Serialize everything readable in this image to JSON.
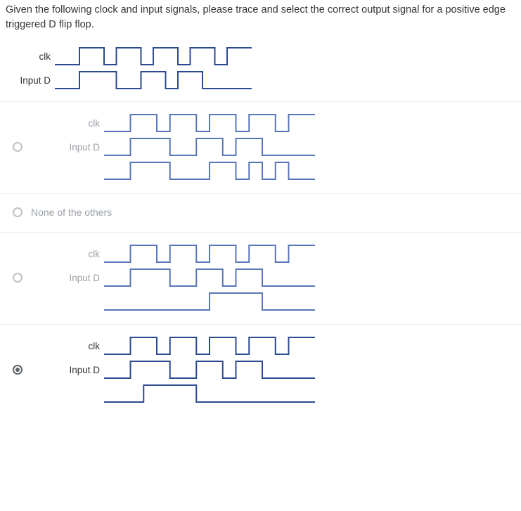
{
  "question": "Given the following clock and input signals, please trace and select the correct output signal for a positive edge triggered D flip flop.",
  "labels": {
    "clk": "clk",
    "inputD": "Input D",
    "none": "None of the others"
  },
  "colors": {
    "waveStroke": "#2b4a8f",
    "waveStrokeLight": "#5976b8",
    "borderGrey": "#eceef0"
  },
  "chart_data": {
    "type": "table",
    "note": "Digital timing waveforms. Values are 0/1 levels per equal time slot. time units span 0..16",
    "clk": [
      0,
      0,
      1,
      1,
      0,
      1,
      1,
      0,
      1,
      1,
      0,
      1,
      1,
      0,
      1,
      1
    ],
    "inputD": [
      0,
      0,
      1,
      1,
      1,
      0,
      0,
      1,
      1,
      0,
      1,
      1,
      0,
      0,
      0,
      0
    ],
    "options": [
      {
        "id": "opt1",
        "selected": false,
        "output": [
          0,
          0,
          1,
          1,
          1,
          0,
          0,
          0,
          1,
          1,
          0,
          1,
          0,
          1,
          0,
          0
        ]
      },
      {
        "id": "opt2_none",
        "selected": false,
        "output": null
      },
      {
        "id": "opt3",
        "selected": false,
        "output": [
          0,
          0,
          0,
          0,
          0,
          0,
          0,
          0,
          1,
          1,
          1,
          1,
          0,
          0,
          0,
          0
        ]
      },
      {
        "id": "opt4",
        "selected": true,
        "output": [
          0,
          0,
          0,
          1,
          1,
          1,
          1,
          0,
          0,
          0,
          0,
          0,
          0,
          0,
          0,
          0
        ]
      }
    ]
  }
}
